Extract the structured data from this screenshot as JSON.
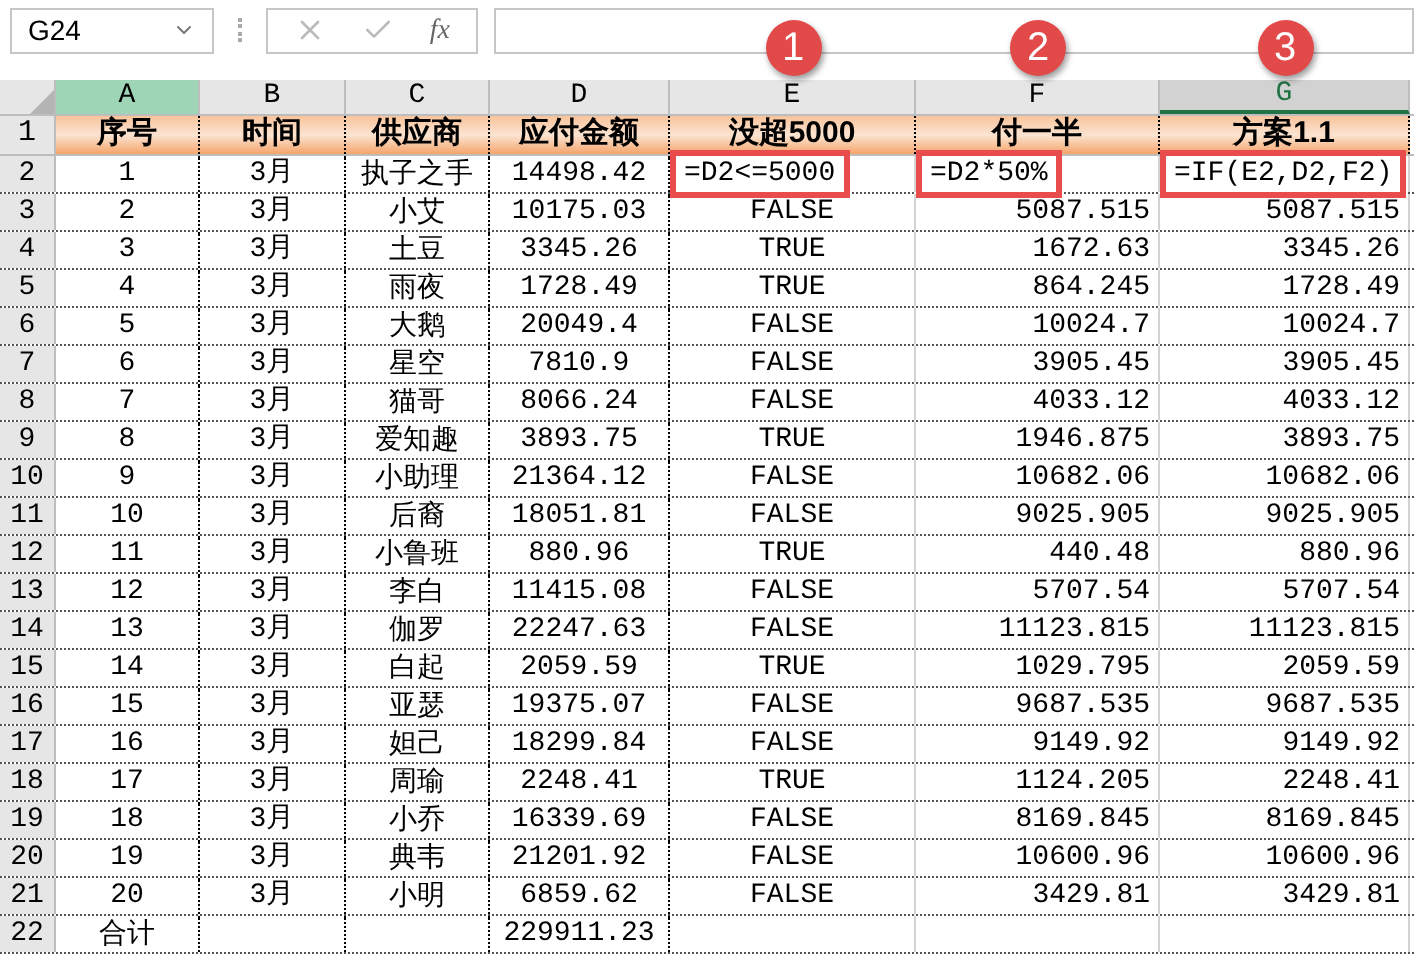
{
  "name_box": {
    "value": "G24"
  },
  "formula_bar": {
    "function_label": "fx"
  },
  "columns": [
    {
      "label": "A",
      "kind": "highlighted"
    },
    {
      "label": "B",
      "kind": "plain"
    },
    {
      "label": "C",
      "kind": "plain"
    },
    {
      "label": "D",
      "kind": "plain"
    },
    {
      "label": "E",
      "kind": "plain"
    },
    {
      "label": "F",
      "kind": "plain"
    },
    {
      "label": "G",
      "kind": "active"
    }
  ],
  "header_row": {
    "number": "1",
    "cells": [
      "序号",
      "时间",
      "供应商",
      "应付金额",
      "没超5000",
      "付一半",
      "方案1.1"
    ]
  },
  "rows": [
    {
      "number": "2",
      "kind": "formula",
      "cells": [
        "1",
        "3月",
        "执子之手",
        "14498.42",
        "=D2<=5000",
        "=D2*50%",
        "=IF(E2,D2,F2)"
      ]
    },
    {
      "number": "3",
      "kind": "data",
      "cells": [
        "2",
        "3月",
        "小艾",
        "10175.03",
        "FALSE",
        "5087.515",
        "5087.515"
      ]
    },
    {
      "number": "4",
      "kind": "data",
      "cells": [
        "3",
        "3月",
        "土豆",
        "3345.26",
        "TRUE",
        "1672.63",
        "3345.26"
      ]
    },
    {
      "number": "5",
      "kind": "data",
      "cells": [
        "4",
        "3月",
        "雨夜",
        "1728.49",
        "TRUE",
        "864.245",
        "1728.49"
      ]
    },
    {
      "number": "6",
      "kind": "data",
      "cells": [
        "5",
        "3月",
        "大鹅",
        "20049.4",
        "FALSE",
        "10024.7",
        "10024.7"
      ]
    },
    {
      "number": "7",
      "kind": "data",
      "cells": [
        "6",
        "3月",
        "星空",
        "7810.9",
        "FALSE",
        "3905.45",
        "3905.45"
      ]
    },
    {
      "number": "8",
      "kind": "data",
      "cells": [
        "7",
        "3月",
        "猫哥",
        "8066.24",
        "FALSE",
        "4033.12",
        "4033.12"
      ]
    },
    {
      "number": "9",
      "kind": "data",
      "cells": [
        "8",
        "3月",
        "爱知趣",
        "3893.75",
        "TRUE",
        "1946.875",
        "3893.75"
      ]
    },
    {
      "number": "10",
      "kind": "data",
      "cells": [
        "9",
        "3月",
        "小助理",
        "21364.12",
        "FALSE",
        "10682.06",
        "10682.06"
      ]
    },
    {
      "number": "11",
      "kind": "data",
      "cells": [
        "10",
        "3月",
        "后裔",
        "18051.81",
        "FALSE",
        "9025.905",
        "9025.905"
      ]
    },
    {
      "number": "12",
      "kind": "data",
      "cells": [
        "11",
        "3月",
        "小鲁班",
        "880.96",
        "TRUE",
        "440.48",
        "880.96"
      ]
    },
    {
      "number": "13",
      "kind": "data",
      "cells": [
        "12",
        "3月",
        "李白",
        "11415.08",
        "FALSE",
        "5707.54",
        "5707.54"
      ]
    },
    {
      "number": "14",
      "kind": "data",
      "cells": [
        "13",
        "3月",
        "伽罗",
        "22247.63",
        "FALSE",
        "11123.815",
        "11123.815"
      ]
    },
    {
      "number": "15",
      "kind": "data",
      "cells": [
        "14",
        "3月",
        "白起",
        "2059.59",
        "TRUE",
        "1029.795",
        "2059.59"
      ]
    },
    {
      "number": "16",
      "kind": "data",
      "cells": [
        "15",
        "3月",
        "亚瑟",
        "19375.07",
        "FALSE",
        "9687.535",
        "9687.535"
      ]
    },
    {
      "number": "17",
      "kind": "data",
      "cells": [
        "16",
        "3月",
        "妲己",
        "18299.84",
        "FALSE",
        "9149.92",
        "9149.92"
      ]
    },
    {
      "number": "18",
      "kind": "data",
      "cells": [
        "17",
        "3月",
        "周瑜",
        "2248.41",
        "TRUE",
        "1124.205",
        "2248.41"
      ]
    },
    {
      "number": "19",
      "kind": "data",
      "cells": [
        "18",
        "3月",
        "小乔",
        "16339.69",
        "FALSE",
        "8169.845",
        "8169.845"
      ]
    },
    {
      "number": "20",
      "kind": "data",
      "cells": [
        "19",
        "3月",
        "典韦",
        "21201.92",
        "FALSE",
        "10600.96",
        "10600.96"
      ]
    },
    {
      "number": "21",
      "kind": "data",
      "cells": [
        "20",
        "3月",
        "小明",
        "6859.62",
        "FALSE",
        "3429.81",
        "3429.81"
      ]
    },
    {
      "number": "22",
      "kind": "total",
      "cells": [
        "合计",
        null,
        null,
        "229911.23",
        null,
        null,
        null
      ]
    }
  ],
  "callouts": [
    {
      "label": "1"
    },
    {
      "label": "2"
    },
    {
      "label": "3"
    }
  ]
}
